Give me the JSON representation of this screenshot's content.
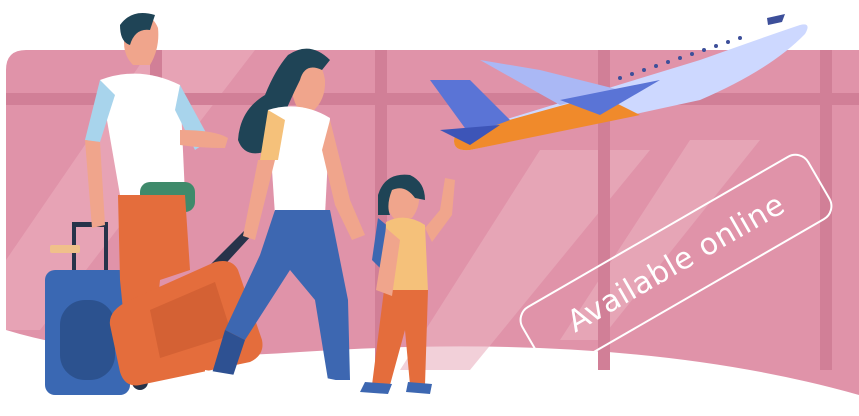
{
  "banner": {
    "stamp_text": "Available online"
  },
  "colors": {
    "background": "#ffffff",
    "window_pink": "#e093a9",
    "frame_pink": "#d17f97",
    "skin": "#f0a58c",
    "navy_hair": "#1f4456",
    "white_shirt": "#ffffff",
    "denim": "#3d67b1",
    "rust": "#e46d3c",
    "suitcase_blue": "#3a68b3",
    "plane_body": "#cdd8ff",
    "plane_orange": "#f08a2b",
    "plane_tail": "#5a74d6"
  },
  "icons": [
    "family-travel-illustration",
    "airplane-icon",
    "suitcase-icon"
  ]
}
